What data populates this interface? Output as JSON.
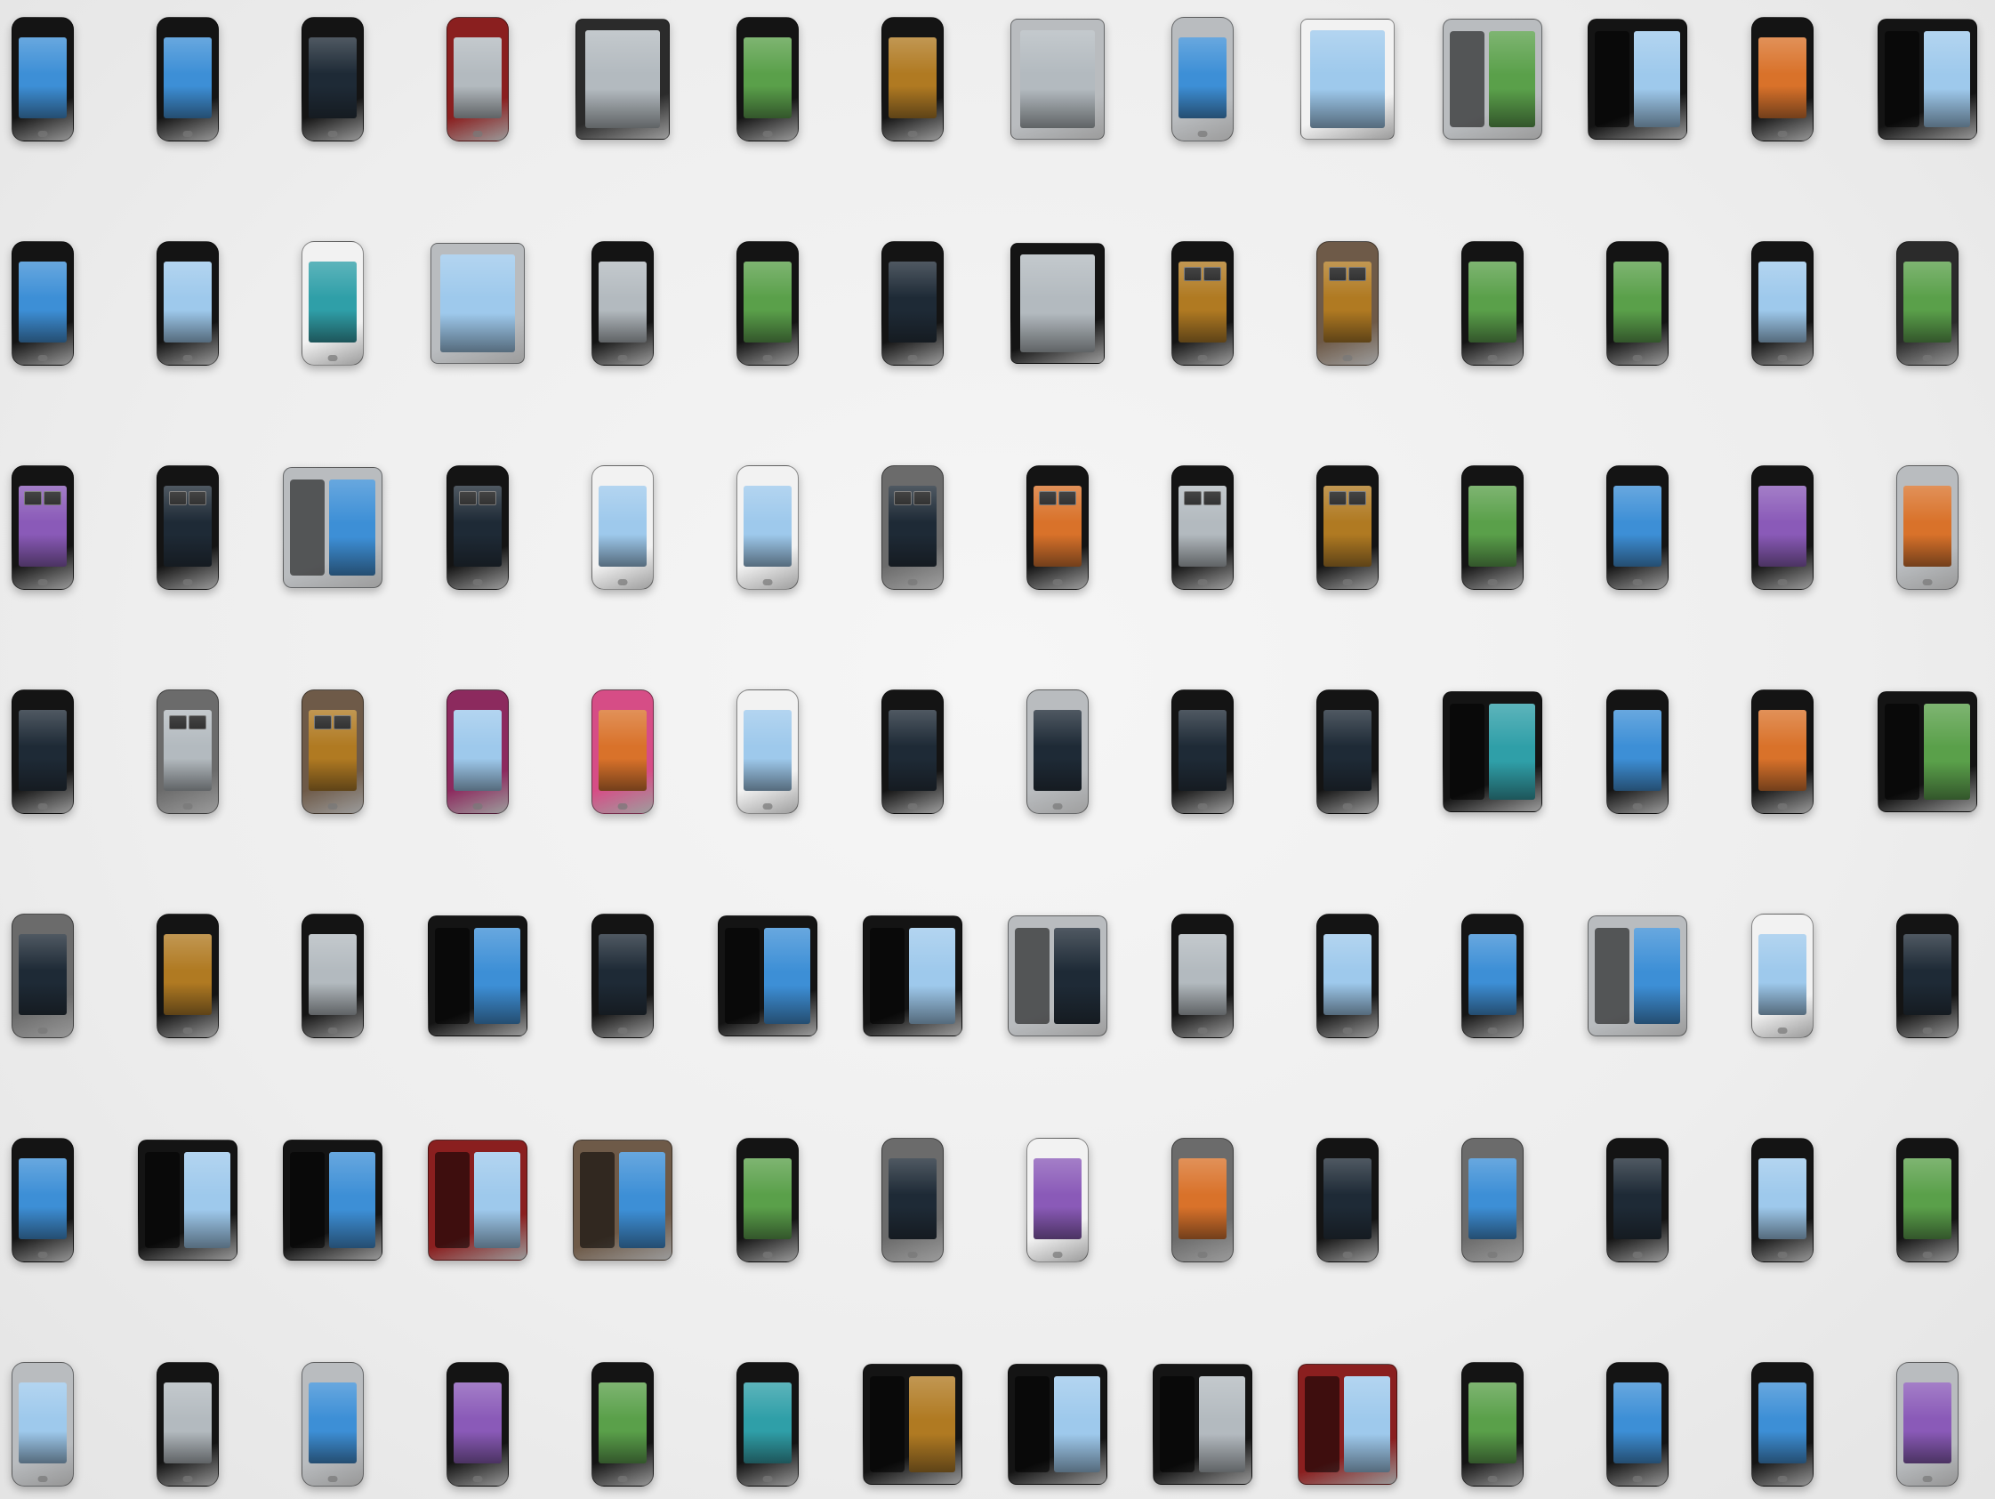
{
  "scene": {
    "kind": "product-collage",
    "rows": 7,
    "columns": 14,
    "total_devices": 98,
    "background": "#efefef"
  },
  "palette": {
    "black": "#141414",
    "graphite": "#2b2b2b",
    "silver": "#b9bcbf",
    "white": "#f2f2f2",
    "grey": "#6b6b6b",
    "red": "#8a1f1f",
    "pink": "#d64d86",
    "magenta": "#8c2a5e",
    "bronze": "#6e5a48",
    "screen_blue": "#3d8fd6",
    "screen_sky": "#9ec9ec",
    "screen_green": "#5aa04a",
    "screen_dark": "#1e2a36",
    "screen_grey": "#b3babf",
    "screen_gold": "#b07a22",
    "screen_purple": "#8a5ab8",
    "screen_teal": "#2f9fa8",
    "screen_orange": "#d9722a"
  },
  "devices": [
    [
      "phone",
      "black",
      "screen_blue",
      "btn"
    ],
    [
      "phone",
      "black",
      "screen_blue",
      ""
    ],
    [
      "phone",
      "black",
      "screen_dark",
      ""
    ],
    [
      "phone",
      "red",
      "screen_grey",
      "btn"
    ],
    [
      "tablet",
      "graphite",
      "screen_grey",
      ""
    ],
    [
      "phone",
      "black",
      "screen_green",
      ""
    ],
    [
      "phone",
      "black",
      "screen_gold",
      ""
    ],
    [
      "tablet",
      "silver",
      "screen_grey",
      ""
    ],
    [
      "phone",
      "silver",
      "screen_blue",
      ""
    ],
    [
      "tablet",
      "white",
      "screen_sky",
      ""
    ],
    [
      "slider",
      "silver",
      "screen_green",
      "keys"
    ],
    [
      "slider",
      "black",
      "screen_sky",
      "keys"
    ],
    [
      "phone",
      "black",
      "screen_orange",
      ""
    ],
    [
      "slider",
      "black",
      "screen_sky",
      "keys"
    ],
    [
      "phone",
      "black",
      "screen_blue",
      ""
    ],
    [
      "phone",
      "black",
      "screen_sky",
      ""
    ],
    [
      "phone",
      "white",
      "screen_teal",
      "btn"
    ],
    [
      "tablet",
      "silver",
      "screen_sky",
      ""
    ],
    [
      "phone",
      "black",
      "screen_grey",
      ""
    ],
    [
      "phone",
      "black",
      "screen_green",
      ""
    ],
    [
      "phone",
      "black",
      "screen_dark",
      ""
    ],
    [
      "tablet",
      "black",
      "screen_grey",
      ""
    ],
    [
      "phone",
      "black",
      "screen_gold",
      "clock"
    ],
    [
      "phone",
      "bronze",
      "screen_gold",
      "clock"
    ],
    [
      "phone",
      "black",
      "screen_green",
      ""
    ],
    [
      "phone",
      "black",
      "screen_green",
      ""
    ],
    [
      "phone",
      "black",
      "screen_sky",
      ""
    ],
    [
      "phone",
      "graphite",
      "screen_green",
      ""
    ],
    [
      "phone",
      "black",
      "screen_purple",
      "clock"
    ],
    [
      "phone",
      "black",
      "screen_dark",
      "clock"
    ],
    [
      "slider",
      "silver",
      "screen_blue",
      "keys"
    ],
    [
      "phone",
      "black",
      "screen_dark",
      "clock"
    ],
    [
      "phone",
      "white",
      "screen_sky",
      ""
    ],
    [
      "phone",
      "white",
      "screen_sky",
      ""
    ],
    [
      "phone",
      "grey",
      "screen_dark",
      "clock"
    ],
    [
      "phone",
      "black",
      "screen_orange",
      "clock"
    ],
    [
      "phone",
      "black",
      "screen_grey",
      "clock"
    ],
    [
      "phone",
      "black",
      "screen_gold",
      "clock"
    ],
    [
      "phone",
      "black",
      "screen_green",
      ""
    ],
    [
      "phone",
      "black",
      "screen_blue",
      ""
    ],
    [
      "phone",
      "black",
      "screen_purple",
      ""
    ],
    [
      "phone",
      "silver",
      "screen_orange",
      ""
    ],
    [
      "phone",
      "black",
      "screen_dark",
      ""
    ],
    [
      "phone",
      "grey",
      "screen_grey",
      "clock"
    ],
    [
      "phone",
      "bronze",
      "screen_gold",
      "clock"
    ],
    [
      "phone",
      "magenta",
      "screen_sky",
      ""
    ],
    [
      "phone",
      "pink",
      "screen_orange",
      ""
    ],
    [
      "phone",
      "white",
      "screen_sky",
      ""
    ],
    [
      "phone",
      "black",
      "screen_dark",
      ""
    ],
    [
      "phone",
      "silver",
      "screen_dark",
      ""
    ],
    [
      "phone",
      "black",
      "screen_dark",
      ""
    ],
    [
      "phone",
      "black",
      "screen_dark",
      ""
    ],
    [
      "slider",
      "black",
      "screen_teal",
      "keys"
    ],
    [
      "phone",
      "black",
      "screen_blue",
      ""
    ],
    [
      "phone",
      "black",
      "screen_orange",
      ""
    ],
    [
      "slider",
      "black",
      "screen_green",
      "keys"
    ],
    [
      "phone",
      "grey",
      "screen_dark",
      ""
    ],
    [
      "phone",
      "black",
      "screen_gold",
      ""
    ],
    [
      "phone",
      "black",
      "screen_grey",
      ""
    ],
    [
      "slider",
      "black",
      "screen_blue",
      "keys"
    ],
    [
      "phone",
      "black",
      "screen_dark",
      ""
    ],
    [
      "slider",
      "black",
      "screen_blue",
      "keys"
    ],
    [
      "slider",
      "black",
      "screen_sky",
      "keys"
    ],
    [
      "slider",
      "silver",
      "screen_dark",
      "keys"
    ],
    [
      "phone",
      "black",
      "screen_grey",
      ""
    ],
    [
      "phone",
      "black",
      "screen_sky",
      ""
    ],
    [
      "phone",
      "black",
      "screen_blue",
      ""
    ],
    [
      "slider",
      "silver",
      "screen_blue",
      "keys"
    ],
    [
      "phone",
      "white",
      "screen_sky",
      ""
    ],
    [
      "phone",
      "black",
      "screen_dark",
      ""
    ],
    [
      "phone",
      "black",
      "screen_blue",
      ""
    ],
    [
      "slider",
      "black",
      "screen_sky",
      "keys"
    ],
    [
      "slider",
      "black",
      "screen_blue",
      "keys"
    ],
    [
      "slider",
      "red",
      "screen_sky",
      "keys"
    ],
    [
      "slider",
      "bronze",
      "screen_blue",
      "keys"
    ],
    [
      "phone",
      "black",
      "screen_green",
      ""
    ],
    [
      "phone",
      "grey",
      "screen_dark",
      ""
    ],
    [
      "phone",
      "white",
      "screen_purple",
      ""
    ],
    [
      "phone",
      "grey",
      "screen_orange",
      ""
    ],
    [
      "phone",
      "black",
      "screen_dark",
      ""
    ],
    [
      "phone",
      "grey",
      "screen_blue",
      ""
    ],
    [
      "phone",
      "black",
      "screen_dark",
      ""
    ],
    [
      "phone",
      "black",
      "screen_sky",
      ""
    ],
    [
      "phone",
      "black",
      "screen_green",
      ""
    ],
    [
      "phone",
      "silver",
      "screen_sky",
      ""
    ],
    [
      "phone",
      "black",
      "screen_grey",
      ""
    ],
    [
      "phone",
      "silver",
      "screen_blue",
      ""
    ],
    [
      "phone",
      "black",
      "screen_purple",
      ""
    ],
    [
      "phone",
      "black",
      "screen_green",
      ""
    ],
    [
      "phone",
      "black",
      "screen_teal",
      ""
    ],
    [
      "slider",
      "black",
      "screen_gold",
      "keys"
    ],
    [
      "slider",
      "black",
      "screen_sky",
      "keys"
    ],
    [
      "slider",
      "black",
      "screen_grey",
      "keys"
    ],
    [
      "slider",
      "red",
      "screen_sky",
      "keys"
    ],
    [
      "phone",
      "black",
      "screen_green",
      ""
    ],
    [
      "phone",
      "black",
      "screen_blue",
      ""
    ],
    [
      "phone",
      "black",
      "screen_blue",
      ""
    ],
    [
      "phone",
      "silver",
      "screen_purple",
      ""
    ]
  ]
}
